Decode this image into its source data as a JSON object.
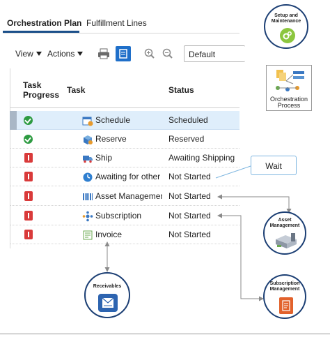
{
  "tabs": [
    {
      "label": "Orchestration Plan",
      "active": true
    },
    {
      "label": "Fulfillment Lines",
      "active": false
    }
  ],
  "toolbar": {
    "view_label": "View",
    "actions_label": "Actions",
    "select_value": "Default",
    "icons": [
      "print-icon",
      "detach-icon",
      "zoom-in-icon",
      "zoom-out-icon"
    ]
  },
  "table": {
    "headers": {
      "progress_line1": "Task",
      "progress_line2": "Progress",
      "task": "Task",
      "status": "Status"
    },
    "rows": [
      {
        "progress": "complete",
        "icon": "calendar-icon",
        "task": "Schedule",
        "status": "Scheduled",
        "selected": true
      },
      {
        "progress": "complete",
        "icon": "reserve-box-icon",
        "task": "Reserve",
        "status": "Reserved",
        "selected": false
      },
      {
        "progress": "not-started",
        "icon": "truck-icon",
        "task": "Ship",
        "status": "Awaiting Shipping",
        "selected": false
      },
      {
        "progress": "not-started",
        "icon": "clock-icon",
        "task": "Awaiting for other lines",
        "status": "Not Started",
        "selected": false
      },
      {
        "progress": "not-started",
        "icon": "barcode-icon",
        "task": "Asset Management",
        "status": "Not Started",
        "selected": false
      },
      {
        "progress": "not-started",
        "icon": "network-icon",
        "task": "Subscription",
        "status": "Not Started",
        "selected": false
      },
      {
        "progress": "not-started",
        "icon": "invoice-icon",
        "task": "Invoice",
        "status": "Not Started",
        "selected": false
      }
    ]
  },
  "callouts": {
    "setup_line1": "Setup and",
    "setup_line2": "Maintenance",
    "orchestration_line1": "Orchestration",
    "orchestration_line2": "Process",
    "wait": "Wait",
    "asset_line1": "Asset",
    "asset_line2": "Management",
    "subscription_line1": "Subscription",
    "subscription_line2": "Management",
    "receivables": "Receivables"
  },
  "colors": {
    "accent": "#1b4f8a",
    "selected_row": "#dfeefb",
    "complete": "#2e9b42",
    "not_started": "#d93a3a",
    "badge_border": "#1c3f74",
    "setup_green": "#8cc63f"
  }
}
